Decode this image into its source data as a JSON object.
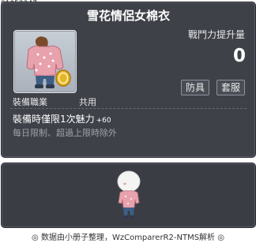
{
  "item_id": "01052347",
  "item": {
    "name": "雪花情侶女棉衣",
    "combat_power_label": "戰鬥力提升量",
    "combat_power_value": "0",
    "category_buttons": [
      "防具",
      "套服"
    ],
    "job_label": "裝備職業",
    "job_value": "共用",
    "equip_effect": "裝備時僅限1次魅力",
    "equip_effect_bonus": "+60",
    "limit_text": "每日限制、超過上限時除外"
  },
  "footer": "◎ 数据由小册子整理，WzComparerR2-NTMS解析 ◎",
  "icons": [
    "sweater-item-icon",
    "gold-coin-icon",
    "avatar-preview"
  ],
  "colors": {
    "panel_bg": "#3f4149",
    "title_text": "#ffffff",
    "muted_text": "#9da1a8"
  }
}
